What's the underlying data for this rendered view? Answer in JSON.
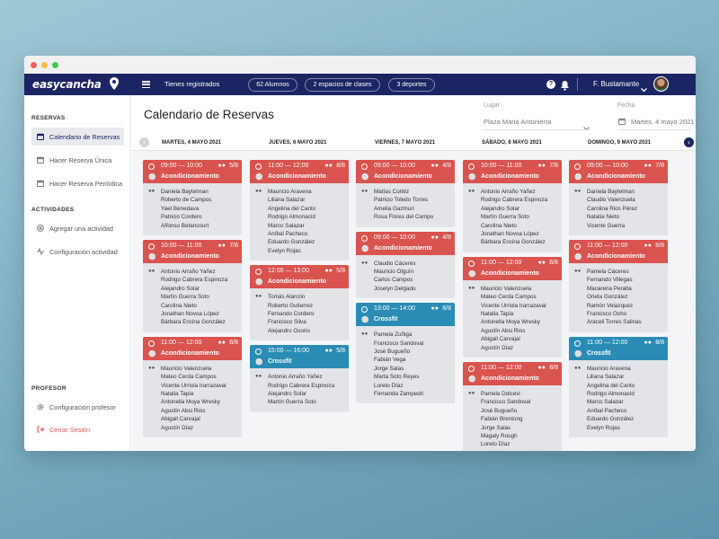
{
  "app": {
    "logo": "easycancha"
  },
  "topbar": {
    "registered_label": "Tienes registrados",
    "pills": [
      "62 Alumnos",
      "2 espacios de clases",
      "3 deportes"
    ],
    "user_name": "F. Bustamante"
  },
  "sidebar": {
    "sections": [
      {
        "title": "RESERVAS",
        "items": [
          {
            "label": "Calendario de Reservas",
            "icon": "calendar-icon",
            "active": true
          },
          {
            "label": "Hacer Reserva Única",
            "icon": "calendar-single-icon",
            "active": false
          },
          {
            "label": "Hacer Reserva Periódica",
            "icon": "calendar-repeat-icon",
            "active": false
          }
        ]
      },
      {
        "title": "ACTIVIDADES",
        "items": [
          {
            "label": "Agregar una actividad",
            "icon": "plus-circle-icon",
            "active": false
          },
          {
            "label": "Configuración actividad",
            "icon": "activity-icon",
            "active": false
          }
        ]
      },
      {
        "title": "PROFESOR",
        "items": [
          {
            "label": "Configuración profesor",
            "icon": "gear-icon",
            "active": false
          },
          {
            "label": "Cerrar Sesión",
            "icon": "logout-icon",
            "active": false
          }
        ]
      }
    ]
  },
  "header": {
    "title": "Calendario de Reservas",
    "filters": {
      "lugar_label": "Lugar",
      "lugar_value": "Plaza Maria Antonierta",
      "fecha_label": "Fecha",
      "fecha_value": "Martes, 4 mayo 2021"
    }
  },
  "colors": {
    "red": "#d9534f",
    "blue": "#2a8cb5",
    "navy": "#1c2563"
  },
  "days": [
    {
      "label": "MARTES, 4 MAYO 2021",
      "cards": [
        {
          "time": "09:00 — 10:00",
          "cap": "5/8",
          "activity": "Acondicionamiento",
          "color": "red",
          "people": [
            "Daniela Baytelman",
            "Roberto de Campos",
            "Yael Benedava",
            "Patricio Cordero",
            "Alfonso Betancourt"
          ]
        },
        {
          "time": "10:00 — 11:00",
          "cap": "7/8",
          "activity": "Acondicionamiento",
          "color": "red",
          "people": [
            "Antonio Arraño Yañez",
            "Rodrigo Cabrera Espinoza",
            "Alejandro Solar",
            "Martín Guerra Soto",
            "Carolina Nieto",
            "Jonathan Novoa López",
            "Bárbara Encina González"
          ]
        },
        {
          "time": "11:00 — 12:00",
          "cap": "8/8",
          "activity": "Acondicionamiento",
          "color": "red",
          "people": [
            "Mauricio Valenzuela",
            "Mateo Cerda Campos",
            "Vicente Urriola Irarrazaval",
            "Natalia Tapia",
            "Antonella Moya Wresky",
            "Agustín Absi Rios",
            "Abigail Carvajal",
            "Agustín Díaz"
          ]
        }
      ]
    },
    {
      "label": "JUEVES, 6 MAYO 2021",
      "cards": [
        {
          "time": "11:00 — 12:00",
          "cap": "8/8",
          "activity": "Acondicionamiento",
          "color": "red",
          "people": [
            "Mauricio Aravena",
            "Liliana Salazar",
            "Angelina del Canto",
            "Rodrigo Almonacid",
            "Marco Salazar",
            "Aníbal Pacheco",
            "Eduardo González",
            "Evelyn Rojas"
          ]
        },
        {
          "time": "12:00 — 13:00",
          "cap": "5/8",
          "activity": "Acondicionamiento",
          "color": "red",
          "people": [
            "Tomás Alarcón",
            "Roberto Gutierrez",
            "Fernando Cordero",
            "Francisco Silva",
            "Alejandro Osorio"
          ]
        },
        {
          "time": "15:00 — 16:00",
          "cap": "5/8",
          "activity": "Crossfit",
          "color": "blue",
          "people": [
            "Antonio Arraño Yañez",
            "Rodrigo Cabrera Espinoza",
            "Alejandro Solar",
            "Martín Guerra Soto"
          ]
        }
      ]
    },
    {
      "label": "VIERNES, 7 MAYO 2021",
      "cards": [
        {
          "time": "09:00 — 10:00",
          "cap": "4/8",
          "activity": "Acondicionamiento",
          "color": "red",
          "people": [
            "Matías Cortéz",
            "Patricio Toledo Torres",
            "Amelia Gazmuri",
            "Rosa Flores del Campo"
          ]
        },
        {
          "time": "09:00 — 10:00",
          "cap": "4/8",
          "activity": "Acondicionamiento",
          "color": "red",
          "people": [
            "Claudio Cáceres",
            "Mauricio Olguín",
            "Carlos Campos",
            "Joselyn Delgado"
          ]
        },
        {
          "time": "13:00 — 14:00",
          "cap": "8/8",
          "activity": "Crossfit",
          "color": "blue",
          "people": [
            "Pamela Zuñiga",
            "Francisco Sandoval",
            "José Bugueño",
            "Fabián Vega",
            "Jorge Salas",
            "Marta Soto Reyes",
            "Loreto Díaz",
            "Fernanda Zampedri"
          ]
        }
      ]
    },
    {
      "label": "SÁBADO, 8 MAYO 2021",
      "cards": [
        {
          "time": "10:00 — 11:00",
          "cap": "7/8",
          "activity": "Acondicionamiento",
          "color": "red",
          "people": [
            "Antonio Arraño Yañez",
            "Rodrigo Cabrera Espinoza",
            "Alejandro Solar",
            "Martín Guerra Soto",
            "Carolina Nieto",
            "Jonathan Novoa López",
            "Bárbara Encina González"
          ]
        },
        {
          "time": "11:00 — 12:00",
          "cap": "8/8",
          "activity": "Acondicionamiento",
          "color": "red",
          "people": [
            "Mauricio Valenzuela",
            "Mateo Cerda Campos",
            "Vicente Urriola Irarrazaval",
            "Natalia Tapia",
            "Antonella Moya Wresky",
            "Agustín Absi Rios",
            "Abigail Carvajal",
            "Agustín Díaz"
          ]
        },
        {
          "time": "11:00 — 12:00",
          "cap": "8/8",
          "activity": "Acondicionamiento",
          "color": "red",
          "people": [
            "Pamela Dolcevi",
            "Francisco Sandoval",
            "José Bugueño",
            "Fabián Brentong",
            "Jorge Salas",
            "Magaly Rough",
            "Loreto Díaz"
          ]
        }
      ]
    },
    {
      "label": "DOMINGO, 9 MAYO 2021",
      "cards": [
        {
          "time": "09:00 — 10:00",
          "cap": "7/8",
          "activity": "Acondicionamiento",
          "color": "red",
          "people": [
            "Daniela Baytelman",
            "Claudio Valenzuela",
            "Carolina Rios Pérez",
            "Natalia Nieto",
            "Vicente Guerra"
          ]
        },
        {
          "time": "11:00 — 12:00",
          "cap": "8/8",
          "activity": "Acondicionamiento",
          "color": "red",
          "people": [
            "Pamela Cáceres",
            "Fernando Villegas",
            "Macarena Peralta",
            "Orieta González",
            "Ramón Velazquez",
            "Francisco Ocho",
            "Araceli Torres Salinas"
          ]
        },
        {
          "time": "11:00 — 12:00",
          "cap": "8/8",
          "activity": "Crossfit",
          "color": "blue",
          "people": [
            "Mauricio Aravena",
            "Liliana Salazar",
            "Angelina del Canto",
            "Rodrigo Almonacid",
            "Marco Salazar",
            "Aníbal Pacheco",
            "Eduardo González",
            "Evelyn Rojas"
          ]
        }
      ]
    }
  ]
}
